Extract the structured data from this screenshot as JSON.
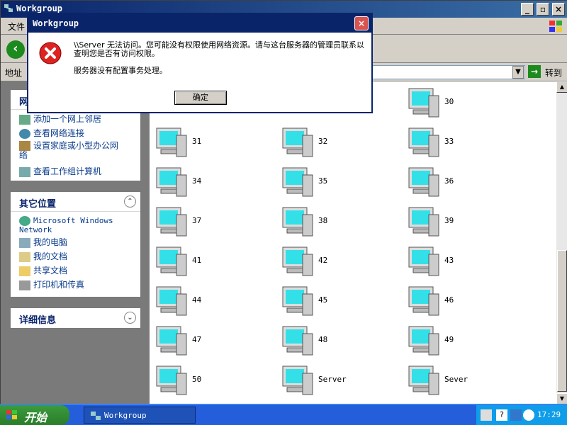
{
  "window": {
    "title": "Workgroup",
    "menu_file": "文件",
    "address_label": "地址",
    "go_label": "转到"
  },
  "left_pane": {
    "network_tasks": {
      "heading": "网",
      "items": [
        "添加一个网上邻居",
        "查看网络连接",
        "设置家庭或小型办公网络",
        "查看工作组计算机"
      ]
    },
    "other_places": {
      "heading": "其它位置",
      "items": [
        "Microsoft Windows Network",
        "我的电脑",
        "我的文档",
        "共享文档",
        "打印机和传真"
      ]
    },
    "details": {
      "heading": "详细信息"
    }
  },
  "computers": [
    "30",
    "31",
    "32",
    "33",
    "34",
    "35",
    "36",
    "37",
    "38",
    "39",
    "41",
    "42",
    "43",
    "44",
    "45",
    "46",
    "47",
    "48",
    "49",
    "50",
    "Server",
    "Sever"
  ],
  "dialog": {
    "title": "Workgroup",
    "message_line1": "\\\\Server 无法访问。您可能没有权限使用网络资源。请与这台服务器的管理员联系以查明您是否有访问权限。",
    "message_line2": "服务器没有配置事务处理。",
    "ok_label": "确定"
  },
  "taskbar": {
    "start_label": "开始",
    "task_item": "Workgroup",
    "clock": "17:29"
  },
  "colors": {
    "title_blue": "#0a246a",
    "taskbar_blue": "#245edb",
    "tray_blue": "#0f9ce8",
    "start_green": "#3c9b3c",
    "error_red": "#d9534f",
    "screen_cyan": "#33e0e8"
  }
}
